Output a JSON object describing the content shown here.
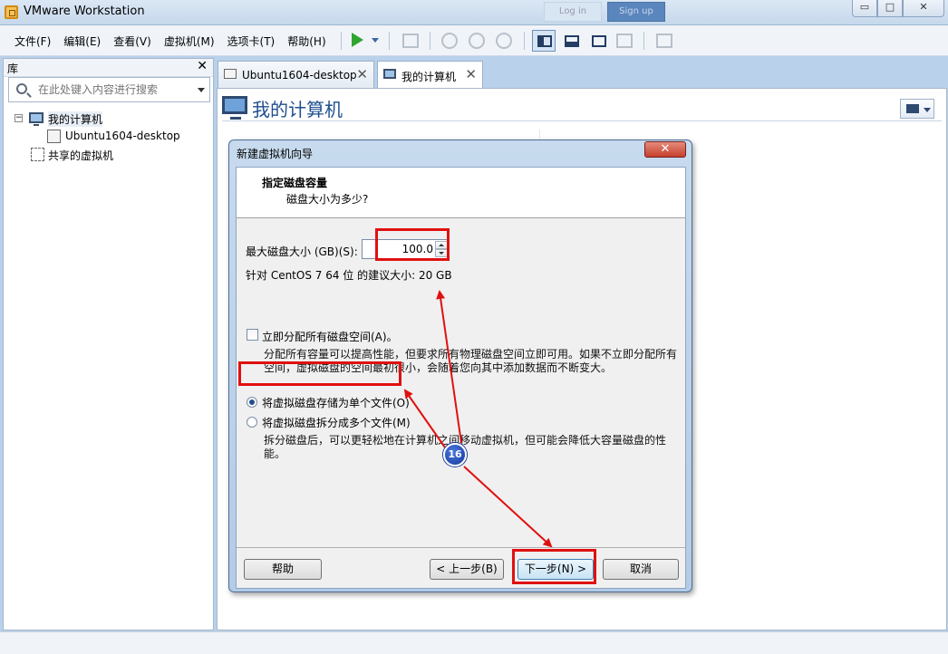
{
  "window": {
    "title": "VMware Workstation",
    "ghost_left": "Log in",
    "ghost_right": "Sign up",
    "controls": {
      "minimize": "▭",
      "maximize": "□",
      "close": "✕"
    }
  },
  "menu": {
    "items": [
      "文件(F)",
      "编辑(E)",
      "查看(V)",
      "虚拟机(M)",
      "选项卡(T)",
      "帮助(H)"
    ]
  },
  "library": {
    "title": "库",
    "close": "✕",
    "search_placeholder": "在此处键入内容进行搜索",
    "tree": {
      "expander": "−",
      "root": "我的计算机",
      "vm": "Ubuntu1604-desktop",
      "shared": "共享的虚拟机"
    }
  },
  "tabs": [
    {
      "label": "Ubuntu1604-desktop",
      "close": "✕"
    },
    {
      "label": "我的计算机",
      "close": "✕"
    }
  ],
  "content": {
    "title": "我的计算机"
  },
  "dialog": {
    "title": "新建虚拟机向导",
    "close": "✕",
    "heading": "指定磁盘容量",
    "subheading": "磁盘大小为多少?",
    "max_size_label": "最大磁盘大小 (GB)(S):",
    "max_size_value": "100.0",
    "recommended": "针对 CentOS 7 64 位 的建议大小: 20 GB",
    "allocate_label": "立即分配所有磁盘空间(A)。",
    "allocate_desc": "分配所有容量可以提高性能，但要求所有物理磁盘空间立即可用。如果不立即分配所有空间，虚拟磁盘的空间最初很小，会随着您向其中添加数据而不断变大。",
    "single_file_label": "将虚拟磁盘存储为单个文件(O)",
    "multi_file_label": "将虚拟磁盘拆分成多个文件(M)",
    "multi_file_desc": "拆分磁盘后，可以更轻松地在计算机之间移动虚拟机，但可能会降低大容量磁盘的性能。",
    "buttons": {
      "help": "帮助",
      "back": "< 上一步(B)",
      "next": "下一步(N) >",
      "cancel": "取消"
    }
  },
  "annotation": {
    "step": "16",
    "color": "#e01010"
  },
  "icons": {
    "app": "vmware-icon",
    "play": "play-icon",
    "search": "search-icon",
    "computer": "computer-icon",
    "vm": "vm-icon",
    "shared": "shared-vm-icon"
  }
}
